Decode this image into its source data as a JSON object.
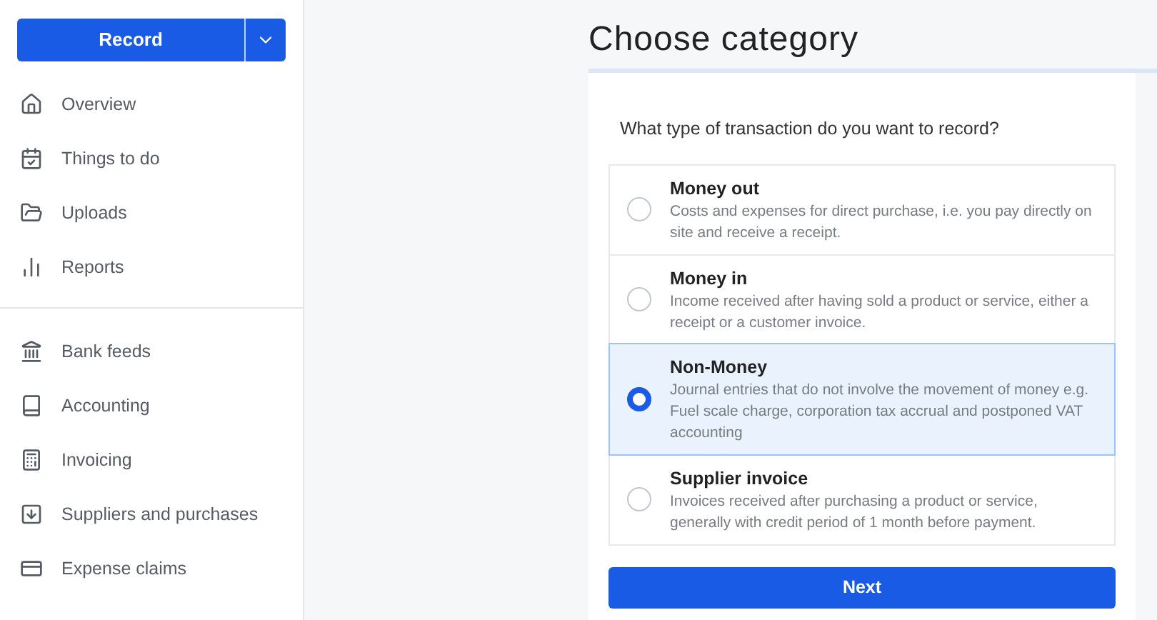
{
  "sidebar": {
    "record_button": {
      "label": "Record"
    },
    "groups": [
      {
        "items": [
          {
            "label": "Overview",
            "kind": "home"
          },
          {
            "label": "Things to do",
            "kind": "calendar"
          },
          {
            "label": "Uploads",
            "kind": "folder"
          },
          {
            "label": "Reports",
            "kind": "chart"
          }
        ]
      },
      {
        "items": [
          {
            "label": "Bank feeds",
            "kind": "bank"
          },
          {
            "label": "Accounting",
            "kind": "book"
          },
          {
            "label": "Invoicing",
            "kind": "invoice"
          },
          {
            "label": "Suppliers and purchases",
            "kind": "inbox"
          },
          {
            "label": "Expense claims",
            "kind": "card"
          }
        ]
      }
    ]
  },
  "main": {
    "title": "Choose category",
    "question": "What type of transaction do you want to record?",
    "options": [
      {
        "title": "Money out",
        "description": "Costs and expenses for direct purchase, i.e. you pay directly on site and receive a receipt.",
        "selected": false
      },
      {
        "title": "Money in",
        "description": "Income received after having sold a product or service, either a receipt or a customer invoice.",
        "selected": false
      },
      {
        "title": "Non-Money",
        "description": "Journal entries that do not involve the movement of money e.g. Fuel scale charge, corporation tax accrual and postponed VAT accounting",
        "selected": true
      },
      {
        "title": "Supplier invoice",
        "description": "Invoices received after purchasing a product or service, generally with credit period of 1 month before payment.",
        "selected": false
      }
    ],
    "next_button": "Next"
  }
}
